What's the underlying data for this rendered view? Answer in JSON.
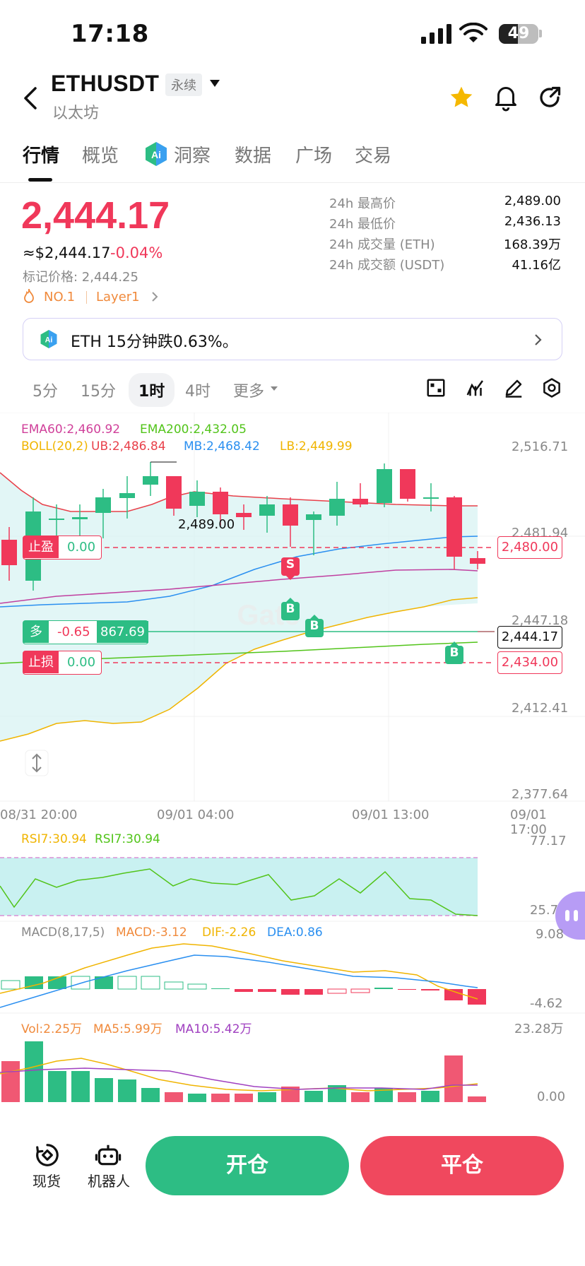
{
  "status": {
    "time": "17:18",
    "battery": "49"
  },
  "header": {
    "symbol": "ETHUSDT",
    "tag": "永续",
    "subtitle": "以太坊"
  },
  "tabs": [
    {
      "label": "行情",
      "active": true
    },
    {
      "label": "概览"
    },
    {
      "label": "洞察"
    },
    {
      "label": "数据"
    },
    {
      "label": "广场"
    },
    {
      "label": "交易"
    }
  ],
  "ticker": {
    "price": "2,444.17",
    "usd": "≈$2,444.17",
    "change": "-0.04%",
    "mark_price": "标记价格: 2,444.25",
    "rank": "NO.1",
    "category": "Layer1",
    "stats": [
      {
        "label": "24h 最高价",
        "value": "2,489.00"
      },
      {
        "label": "24h 最低价",
        "value": "2,436.13"
      },
      {
        "label": "24h 成交量 (ETH)",
        "value": "168.39万"
      },
      {
        "label": "24h 成交额 (USDT)",
        "value": "41.16亿"
      }
    ]
  },
  "banner": {
    "text": "ETH 15分钟跌0.63%。"
  },
  "timeframes": [
    {
      "label": "5分"
    },
    {
      "label": "15分"
    },
    {
      "label": "1时",
      "active": true
    },
    {
      "label": "4时"
    },
    {
      "label": "更多"
    }
  ],
  "indicators": {
    "ema60": "EMA60:2,460.92",
    "ema200": "EMA200:2,432.05",
    "boll": "BOLL(20,2)",
    "ub": "UB:2,486.84",
    "mb": "MB:2,468.42",
    "lb": "LB:2,449.99"
  },
  "price_axis": [
    "2,516.71",
    "2,481.94",
    "2,447.18",
    "2,412.41",
    "2,377.64"
  ],
  "chart_overlays": {
    "high_label": "2,489.00",
    "take_profit": {
      "label": "止盈",
      "value": "0.00",
      "price": "2,480.00"
    },
    "position": {
      "side": "多",
      "pnl": "-0.65",
      "amount": "867.69",
      "price": "2,444.17"
    },
    "stop_loss": {
      "label": "止损",
      "value": "0.00",
      "price": "2,434.00"
    },
    "signals": [
      "B",
      "B",
      "S",
      "B"
    ]
  },
  "dates": [
    "08/31 20:00",
    "09/01 04:00",
    "09/01 13:00",
    "09/01 17:00"
  ],
  "rsi": {
    "rsi7a": "RSI7:30.94",
    "rsi7b": "RSI7:30.94",
    "high": "77.17",
    "low": "25.71"
  },
  "macd": {
    "title": "MACD(8,17,5)",
    "macd": "MACD:-3.12",
    "dif": "DIF:-2.26",
    "dea": "DEA:0.86",
    "high": "9.08",
    "low": "-4.62"
  },
  "vol": {
    "vol": "Vol:2.25万",
    "ma5": "MA5:5.99万",
    "ma10": "MA10:5.42万",
    "high": "23.28万",
    "low": "0.00"
  },
  "bottom": {
    "spot": "现货",
    "robot": "机器人",
    "open": "开仓",
    "close": "平仓"
  },
  "colors": {
    "up": "#2dbd84",
    "down": "#f0385a",
    "accent_orange": "#f08a3c"
  }
}
